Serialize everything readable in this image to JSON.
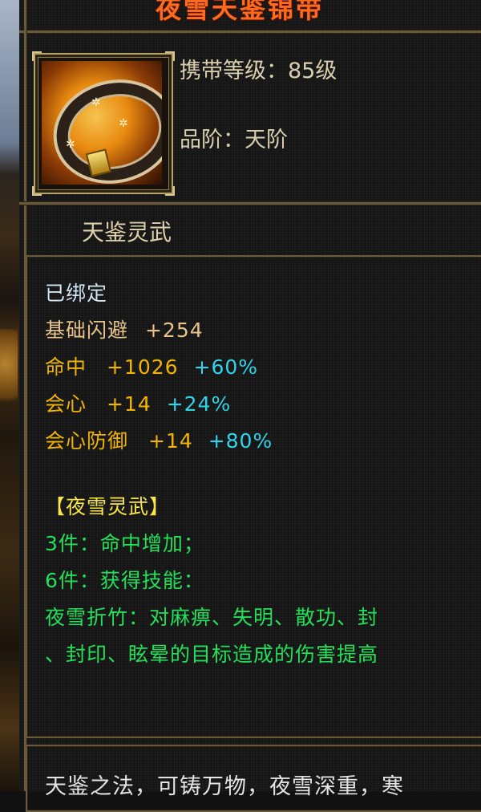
{
  "item": {
    "name": "夜雪天鉴锦带",
    "icon": "belt-icon",
    "level_label": "携带等级：85级",
    "grade_label": "品阶：天阶",
    "category": "天鉴灵武"
  },
  "attributes": {
    "bound": "已绑定",
    "base": {
      "name": "基础闪避",
      "value": "+254"
    },
    "stats": [
      {
        "name": "命中",
        "value": "+1026",
        "bonus": "+60%"
      },
      {
        "name": "会心",
        "value": "+14",
        "bonus": "+24%"
      },
      {
        "name": "会心防御",
        "value": "+14",
        "bonus": "+80%"
      }
    ]
  },
  "set": {
    "title": "【夜雪灵武】",
    "bonus3": "3件：命中增加；",
    "bonus6": "6件：获得技能：",
    "skill_line1": "夜雪折竹：对麻痹、失明、散功、封",
    "skill_line2": "、封印、眩晕的目标造成的伤害提高"
  },
  "description": "天鉴之法，可铸万物，夜雪深重，寒",
  "colors": {
    "title": "#ff6a1e",
    "bound": "#cfe6f3",
    "stat": "#f1b500",
    "bonus": "#2fd4ea",
    "set_title": "#f7e64a",
    "set_effect": "#23e05a"
  }
}
